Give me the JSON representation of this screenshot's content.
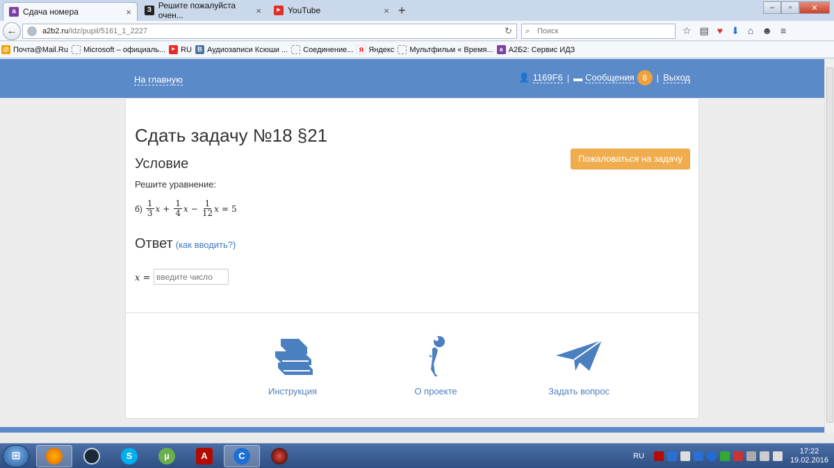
{
  "browser": {
    "tabs": [
      {
        "label": "Сдача номера",
        "favicon_color": "#7b3fa0",
        "favicon_glyph": "a",
        "active": true
      },
      {
        "label": "Решите пожалуйста очен...",
        "favicon_color": "#222222",
        "favicon_glyph": "З",
        "active": false
      },
      {
        "label": "YouTube",
        "favicon_color": "#e52d27",
        "favicon_glyph": "▶",
        "active": false
      }
    ],
    "new_tab": "+",
    "close_glyph": "×",
    "url_host": "a2b2.ru",
    "url_path": "/idz/pupil/5161_1_2227",
    "search_placeholder": "Поиск",
    "bookmarks": [
      {
        "label": "Почта@Mail.Ru",
        "icon": "mail-icon",
        "color": "#f0a000",
        "glyph": "@"
      },
      {
        "label": "Microsoft – официаль...",
        "icon": "page-icon",
        "color": "",
        "glyph": ""
      },
      {
        "label": "RU",
        "icon": "youtube-icon",
        "color": "#e52d27",
        "glyph": "▶"
      },
      {
        "label": "Аудиозаписи Ксюши ...",
        "icon": "vk-icon",
        "color": "#4c75a3",
        "glyph": "В"
      },
      {
        "label": "Соединение...",
        "icon": "page-icon",
        "color": "",
        "glyph": ""
      },
      {
        "label": "Яндекс",
        "icon": "yandex-icon",
        "color": "#ffffff",
        "glyph": "Я"
      },
      {
        "label": "Мультфильм « Время...",
        "icon": "page-icon",
        "color": "",
        "glyph": ""
      },
      {
        "label": "А2Б2: Сервис ИДЗ",
        "icon": "a2b2-icon",
        "color": "#7b3fa0",
        "glyph": "a"
      }
    ]
  },
  "site": {
    "home_link": "На главную",
    "user_id": "1169F6",
    "messages_label": "Сообщения",
    "messages_count": "8",
    "separator": "|",
    "logout_label": "Выход",
    "accent": "#5a8ac8"
  },
  "task": {
    "title": "Сдать задачу №18 §21",
    "condition_heading": "Условие",
    "complain_button": "Пожаловаться на задачу",
    "condition_text": "Решите уравнение:",
    "eq_prefix": "б)",
    "eq": {
      "f1_num": "1",
      "f1_den": "3",
      "f2_num": "1",
      "f2_den": "4",
      "f3_num": "1",
      "f3_den": "12",
      "var": "x",
      "plus": "+",
      "minus": "−",
      "equals": "=",
      "rhs": "5"
    },
    "answer_heading": "Ответ",
    "howto_link": "(как вводить?)",
    "answer_label": "x =",
    "answer_placeholder": "введите число"
  },
  "footer": {
    "items": [
      {
        "label": "Инструкция",
        "icon": "books-icon"
      },
      {
        "label": "О проекте",
        "icon": "info-icon"
      },
      {
        "label": "Задать вопрос",
        "icon": "paper-plane-icon"
      }
    ]
  },
  "taskbar": {
    "apps": [
      {
        "icon": "firefox-icon",
        "color": "#e66000",
        "glyph": "",
        "active": true
      },
      {
        "icon": "steam-icon",
        "color": "#1b2838",
        "glyph": "",
        "active": false
      },
      {
        "icon": "skype-icon",
        "color": "#00aff0",
        "glyph": "S",
        "active": false
      },
      {
        "icon": "utorrent-icon",
        "color": "#6ab04c",
        "glyph": "µ",
        "active": false
      },
      {
        "icon": "acrobat-icon",
        "color": "#b30b00",
        "glyph": "A",
        "active": false
      },
      {
        "icon": "ccleaner-icon",
        "color": "#1d6fd6",
        "glyph": "C",
        "active": true
      },
      {
        "icon": "game-icon",
        "color": "#c0392b",
        "glyph": "",
        "active": false
      }
    ],
    "lang": "RU",
    "time": "17:22",
    "date": "19.02.2016"
  }
}
